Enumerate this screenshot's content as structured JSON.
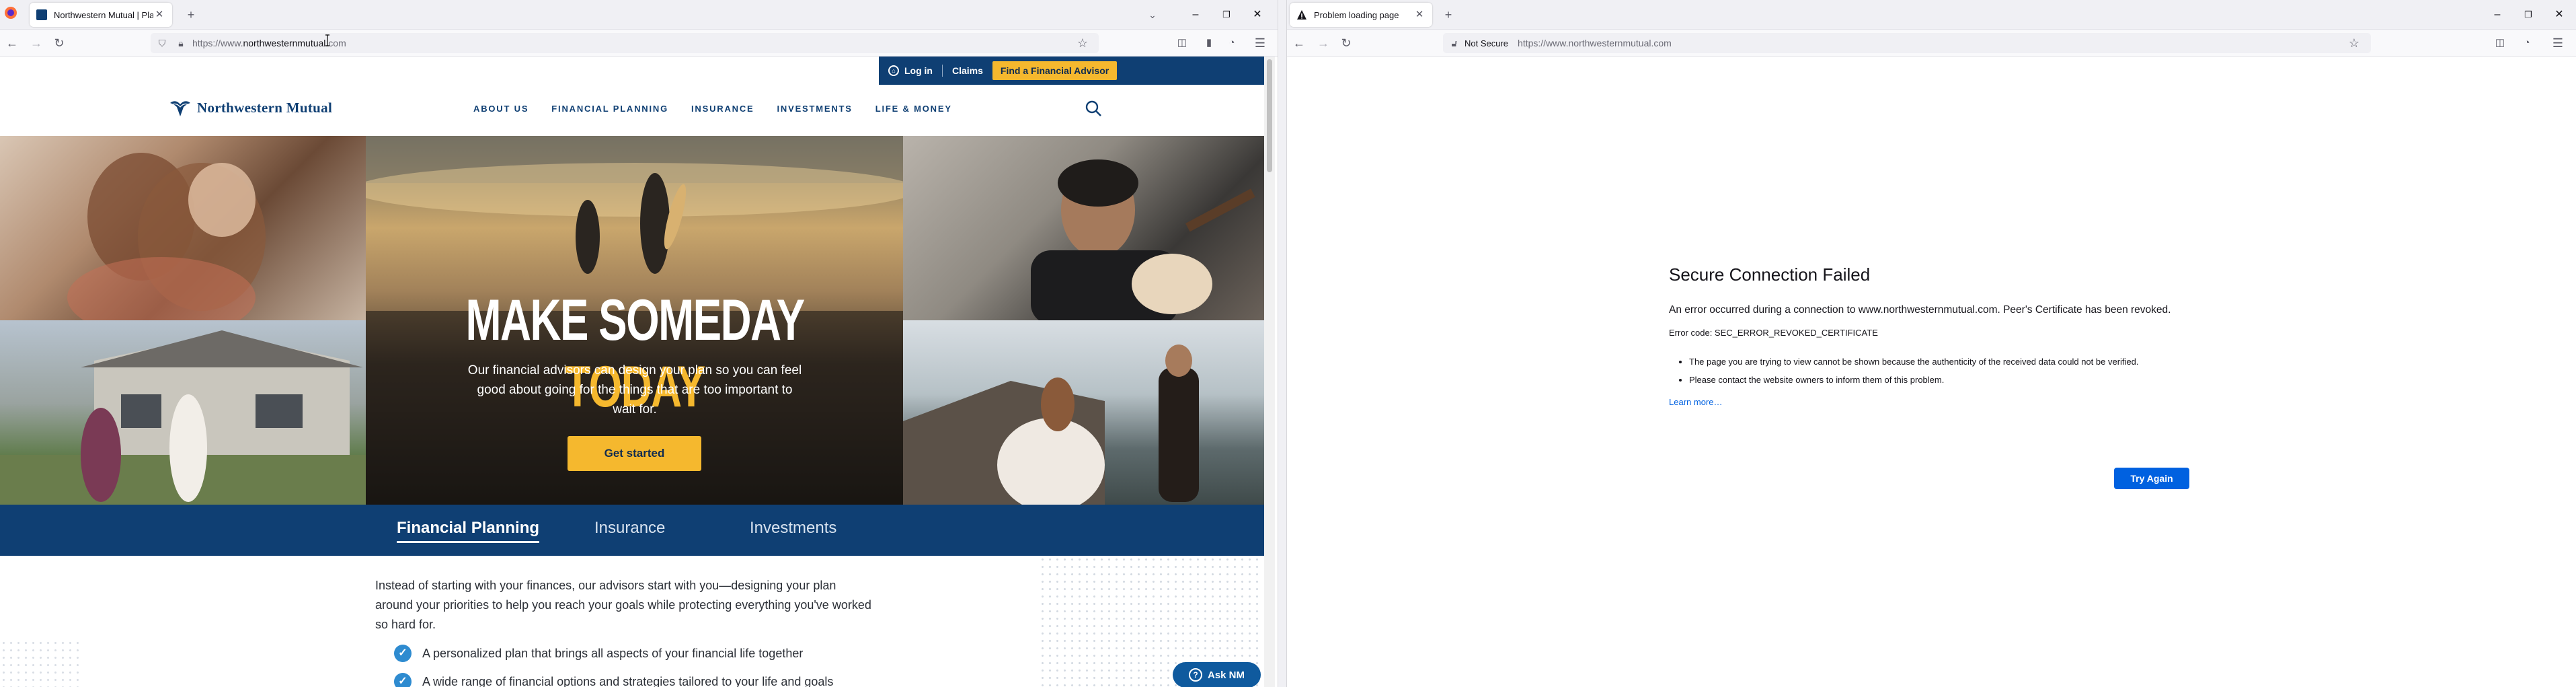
{
  "left_window": {
    "tab": {
      "title": "Northwestern Mutual | Plannin"
    },
    "url": {
      "prefix": "https://www.",
      "domain": "northwesternmutual",
      "suffix": ".com"
    },
    "utility_nav": {
      "login": "Log in",
      "claims": "Claims",
      "find_advisor": "Find a Financial Advisor"
    },
    "logo_text": "Northwestern Mutual",
    "main_nav": [
      "ABOUT US",
      "FINANCIAL PLANNING",
      "INSURANCE",
      "INVESTMENTS",
      "LIFE & MONEY"
    ],
    "hero": {
      "title_white": "MAKE SOMEDAY",
      "title_gold": "TODAY",
      "subtitle": "Our financial advisors can design your plan so you can feel good about going for the things that are too important to wait for.",
      "cta": "Get started"
    },
    "pillars": [
      "Financial Planning",
      "Insurance",
      "Investments"
    ],
    "intro": "Instead of starting with your finances, our advisors start with you—designing your plan around your priorities to help you reach your goals while protecting everything you've worked so hard for.",
    "checklist": [
      "A personalized plan that brings all aspects of your financial life together",
      "A wide range of financial options and strategies tailored to your life and goals"
    ],
    "ask_button": "Ask NM",
    "colors": {
      "navy": "#0f3f73",
      "gold": "#f5b82e",
      "check_blue": "#2e8bd0"
    }
  },
  "right_window": {
    "tab": {
      "title": "Problem loading page"
    },
    "not_secure": "Not Secure",
    "url": {
      "prefix": "https://www.",
      "domain": "northwesternmutual",
      "suffix": ".com"
    },
    "error": {
      "title": "Secure Connection Failed",
      "description": "An error occurred during a connection to www.northwesternmutual.com. Peer's Certificate has been revoked.",
      "code": "Error code: SEC_ERROR_REVOKED_CERTIFICATE",
      "bullets": [
        "The page you are trying to view cannot be shown because the authenticity of the received data could not be verified.",
        "Please contact the website owners to inform them of this problem."
      ],
      "learn_more": "Learn more…",
      "try_again": "Try Again"
    },
    "colors": {
      "link_blue": "#0061e0"
    }
  }
}
